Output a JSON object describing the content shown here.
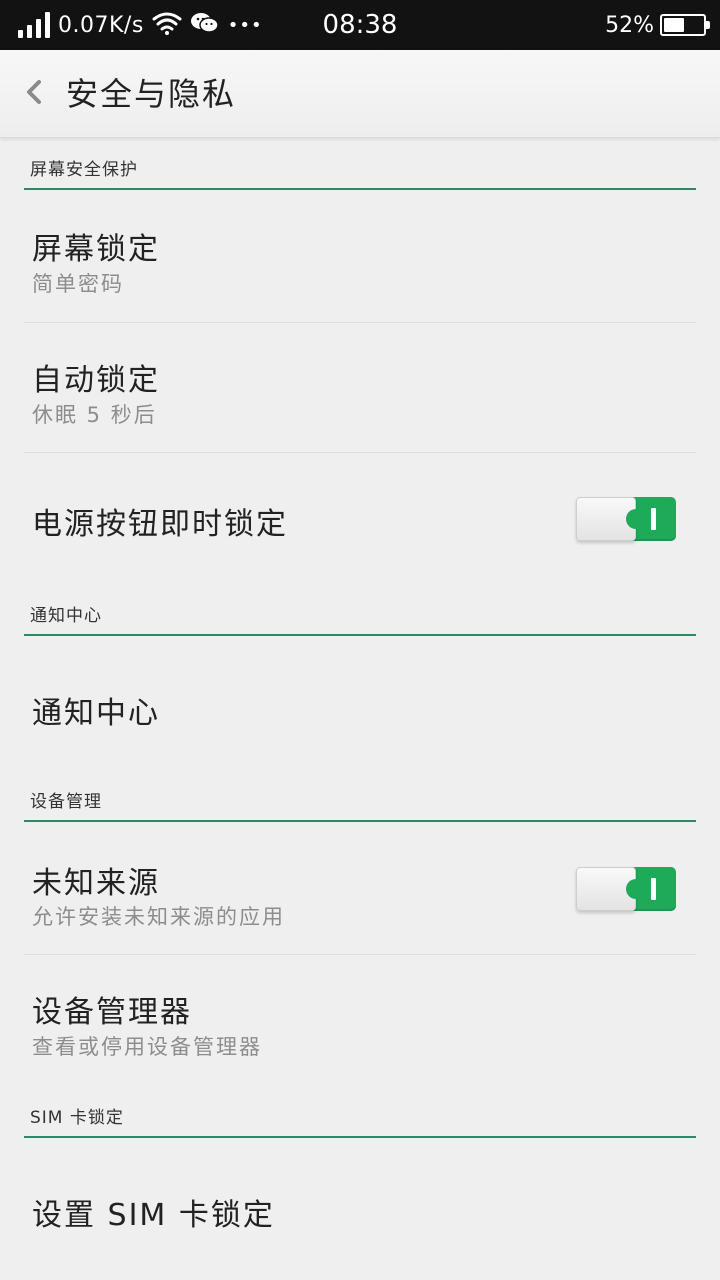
{
  "status_bar": {
    "net_speed": "0.07K/s",
    "time": "08:38",
    "battery_percent": "52%",
    "battery_level": 0.52,
    "more_dots": "•••",
    "icons": [
      "signal-icon",
      "wifi-icon",
      "wechat-icon",
      "battery-icon"
    ]
  },
  "header": {
    "title": "安全与隐私",
    "back_icon": "chevron-left-icon"
  },
  "sections": {
    "screen_security": {
      "header": "屏幕安全保护",
      "screen_lock": {
        "title": "屏幕锁定",
        "subtitle": "简单密码"
      },
      "auto_lock": {
        "title": "自动锁定",
        "subtitle": "休眠 5 秒后"
      },
      "power_button_lock": {
        "title": "电源按钮即时锁定",
        "toggle_on": true
      }
    },
    "notification_center": {
      "header": "通知中心",
      "item": {
        "title": "通知中心"
      }
    },
    "device_management": {
      "header": "设备管理",
      "unknown_sources": {
        "title": "未知来源",
        "subtitle": "允许安装未知来源的应用",
        "toggle_on": true
      },
      "device_admins": {
        "title": "设备管理器",
        "subtitle": "查看或停用设备管理器"
      }
    },
    "sim_lock": {
      "header": "SIM 卡锁定",
      "item": {
        "title": "设置 SIM 卡锁定"
      }
    }
  },
  "colors": {
    "accent_green": "#1faa5a",
    "divider_green": "#2a8a63",
    "background": "#efefef",
    "status_bar": "#121212"
  }
}
